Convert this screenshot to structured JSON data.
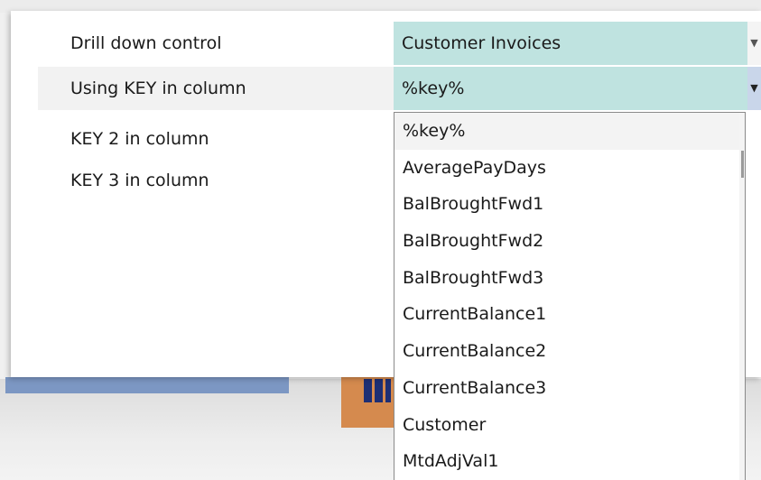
{
  "dialog": {
    "rows": [
      {
        "label": "Drill down control"
      },
      {
        "label": "Using KEY in column"
      },
      {
        "label": "KEY 2 in column"
      },
      {
        "label": "KEY 3 in column"
      }
    ],
    "drill_down_value": "Customer Invoices",
    "key_column_value": "%key%"
  },
  "dropdown": {
    "options": [
      "%key%",
      "AveragePayDays",
      "BalBroughtFwd1",
      "BalBroughtFwd2",
      "BalBroughtFwd3",
      "CurrentBalance1",
      "CurrentBalance2",
      "CurrentBalance3",
      "Customer",
      "MtdAdjVal1"
    ],
    "selected": "%key%"
  },
  "icons": {
    "dropdown_caret": "chevron-down-icon"
  },
  "colors": {
    "field_bg": "#bfe3e0",
    "active_caret_bg": "#c9d6ea",
    "panel_bg": "#ffffff"
  }
}
